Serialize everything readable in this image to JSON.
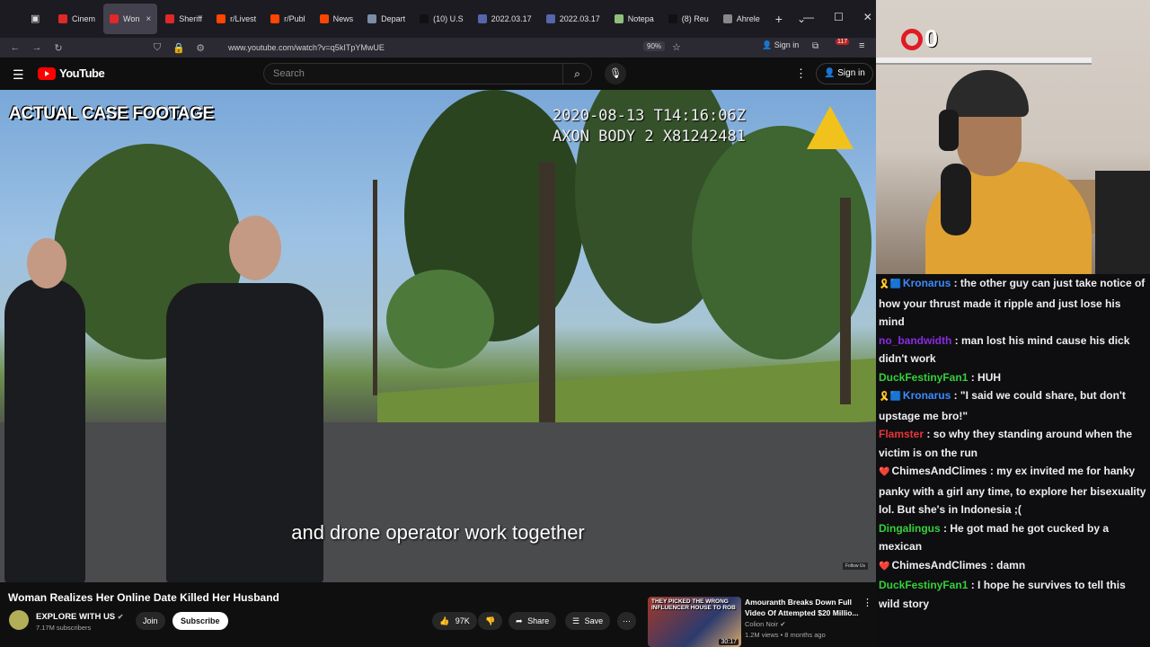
{
  "browser": {
    "tabs": [
      {
        "label": "Cinem",
        "color": "#e02828",
        "active": false
      },
      {
        "label": "Won",
        "color": "#e02828",
        "active": true
      },
      {
        "label": "Sheriff",
        "color": "#e02828",
        "active": false
      },
      {
        "label": "r/Livest",
        "color": "#ff4500",
        "active": false
      },
      {
        "label": "r/Publ",
        "color": "#ff4500",
        "active": false
      },
      {
        "label": "News",
        "color": "#ff4500",
        "active": false
      },
      {
        "label": "Depart",
        "color": "#7a8ea8",
        "active": false
      },
      {
        "label": "(10) U.S",
        "color": "#111111",
        "active": false
      },
      {
        "label": "2022.03.17",
        "color": "#5566aa",
        "active": false
      },
      {
        "label": "2022.03.17",
        "color": "#5566aa",
        "active": false
      },
      {
        "label": "Notepa",
        "color": "#8fbf7a",
        "active": false
      },
      {
        "label": "(8) Reu",
        "color": "#111111",
        "active": false
      },
      {
        "label": "Ahrele",
        "color": "#888888",
        "active": false
      }
    ],
    "tab_close": "×",
    "new_tab": "+",
    "url": "www.youtube.com/watch?v=q5kITpYMwUE",
    "zoom": "90%",
    "sign_in": "Sign in",
    "notif_count": "117"
  },
  "youtube": {
    "logo": "YouTube",
    "search_placeholder": "Search",
    "sign_in": "Sign in"
  },
  "video": {
    "overlay_label": "ACTUAL CASE FOOTAGE",
    "timestamp_line1": "2020-08-13 T14:16:06Z",
    "timestamp_line2": "AXON BODY 2 X81242481",
    "subtitle": "and drone operator work together",
    "watermark": "Follow Us"
  },
  "meta": {
    "title": "Woman Realizes Her Online Date Killed Her Husband",
    "channel": "EXPLORE WITH US",
    "subscribers": "7.17M subscribers",
    "join": "Join",
    "subscribe": "Subscribe",
    "likes": "97K",
    "share": "Share",
    "save": "Save"
  },
  "recommended": {
    "thumb_text": "THEY PICKED THE WRONG INFLUENCER HOUSE TO ROB",
    "duration": "30:17",
    "title": "Amouranth Breaks Down Full Video Of Attempted $20 Millio...",
    "channel": "Colion Noir",
    "meta": "1.2M views • 8 months ago"
  },
  "stream": {
    "counter": "0"
  },
  "chat": [
    {
      "badge": "🎗️🟦",
      "user": "Kronarus",
      "color": "#3d8bff",
      "text": "the other guy can just take notice of how your thrust made it ripple and just lose his mind"
    },
    {
      "badge": "",
      "user": "no_bandwidth",
      "color": "#8a2be2",
      "text": "man lost his mind cause his dick didn't work"
    },
    {
      "badge": "",
      "user": "DuckFestinyFan1",
      "color": "#35d03a",
      "text": "HUH"
    },
    {
      "badge": "🎗️🟦",
      "user": "Kronarus",
      "color": "#3d8bff",
      "text": "\"I said we could share, but don't upstage me bro!\""
    },
    {
      "badge": "",
      "user": "Flamster",
      "color": "#e8343a",
      "text": "so why they standing around when the victim is on the run"
    },
    {
      "badge": "❤️",
      "user": "ChimesAndClimes",
      "color": "#efeff1",
      "text": "my ex invited me for hanky panky with a girl any time, to explore her bisexuality lol. But she's in Indonesia ;("
    },
    {
      "badge": "",
      "user": "Dingalingus",
      "color": "#35d03a",
      "text": "He got mad he got cucked by a mexican"
    },
    {
      "badge": "❤️",
      "user": "ChimesAndClimes",
      "color": "#efeff1",
      "text": "damn"
    },
    {
      "badge": "",
      "user": "DuckFestinyFan1",
      "color": "#35d03a",
      "text": "I hope he survives to tell this wild story"
    }
  ]
}
